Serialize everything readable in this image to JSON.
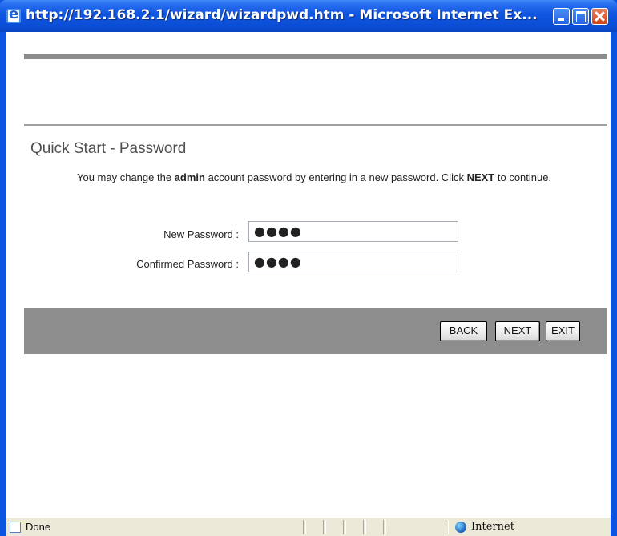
{
  "window": {
    "title": "http://192.168.2.1/wizard/wizardpwd.htm - Microsoft Internet Ex..."
  },
  "page": {
    "heading": "Quick Start - Password",
    "description": {
      "part1": "You may change the ",
      "bold1": "admin",
      "part2": " account password by entering in a new password. Click ",
      "bold2": "NEXT",
      "part3": " to continue."
    },
    "fields": {
      "new_password": {
        "label": "New Password :",
        "value": "●●●●"
      },
      "confirmed_password": {
        "label": "Confirmed Password :",
        "value": "●●●●"
      }
    },
    "buttons": {
      "back": "BACK",
      "next": "NEXT",
      "exit": "EXIT"
    }
  },
  "statusbar": {
    "status": "Done",
    "zone": "Internet"
  },
  "colors": {
    "title_bar": "#0b4ed6",
    "button_bar": "#8d8d8d",
    "heading": "#505050"
  }
}
